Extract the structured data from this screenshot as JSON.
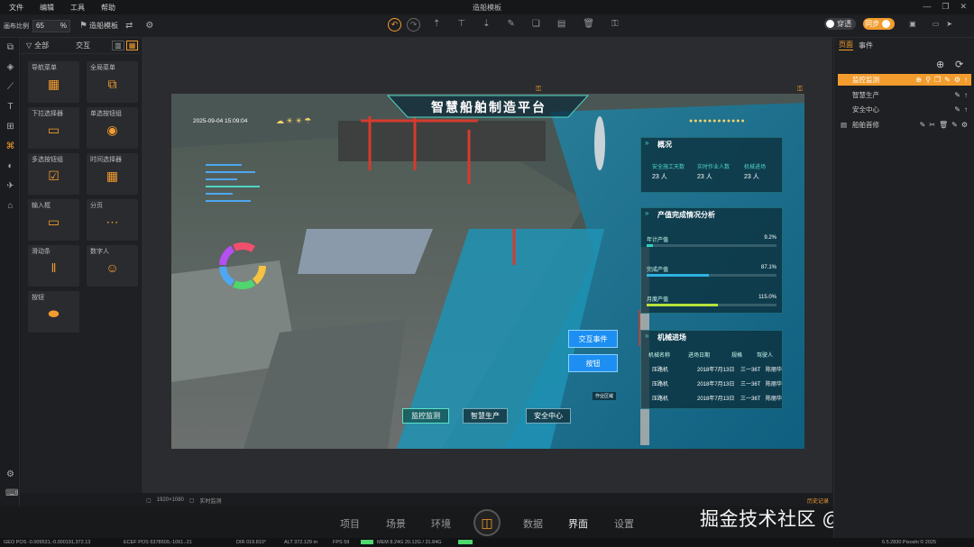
{
  "menu": {
    "items": [
      "文件",
      "编辑",
      "工具",
      "帮助"
    ],
    "title": "造船模板"
  },
  "toolbar": {
    "scale_label": "画布比例",
    "scale_value": "65",
    "scale_unit": "%",
    "template_label": "造船模板"
  },
  "toggles": {
    "left": "穿透",
    "right": "同步"
  },
  "component_panel": {
    "filter_all": "全部",
    "filter_interact": "交互",
    "cards": [
      {
        "label": "导航菜单",
        "icon": "grid-icon"
      },
      {
        "label": "全局菜单",
        "icon": "tree-icon"
      },
      {
        "label": "下拉选择器",
        "icon": "dropdown-icon"
      },
      {
        "label": "单选按钮组",
        "icon": "radio-group-icon"
      },
      {
        "label": "多选按钮组",
        "icon": "checkbox-group-icon"
      },
      {
        "label": "时间选择器",
        "icon": "calendar-icon"
      },
      {
        "label": "输入框",
        "icon": "input-icon"
      },
      {
        "label": "分页",
        "icon": "pagination-icon"
      },
      {
        "label": "滑动条",
        "icon": "slider-icon"
      },
      {
        "label": "数字人",
        "icon": "avatar-icon"
      },
      {
        "label": "按钮",
        "icon": "button-icon"
      }
    ]
  },
  "dashboard": {
    "title": "智慧船舶制造平台",
    "datetime": "2025-09-04 15:09:04",
    "overview": {
      "title": "概况",
      "items": [
        {
          "label": "安全施工天数",
          "value": "23",
          "unit": "人"
        },
        {
          "label": "实时作业人数",
          "value": "23",
          "unit": "人"
        },
        {
          "label": "机械进场",
          "value": "23",
          "unit": "人"
        }
      ]
    },
    "output": {
      "title": "产值完成情况分析",
      "rows": [
        {
          "label": "年计产值",
          "percent": 9.2,
          "display": "9.2%",
          "color": "#2fd2c0"
        },
        {
          "label": "完成产值",
          "percent": 87.1,
          "display": "87.1%",
          "color": "#2fb3e0"
        },
        {
          "label": "月度产值",
          "percent": 115.0,
          "display": "115.0%",
          "color": "#b6e23c"
        }
      ]
    },
    "machinery": {
      "title": "机械进场",
      "headers": [
        "机械名称",
        "进场日期",
        "规格",
        "驾驶人"
      ],
      "rows": [
        [
          "压路机",
          "2018年7月13日",
          "三一36T",
          "陈丽华"
        ],
        [
          "压路机",
          "2018年7月13日",
          "三一36T",
          "陈丽华"
        ],
        [
          "压路机",
          "2018年7月13日",
          "三一36T",
          "陈丽华"
        ]
      ]
    },
    "buttons": {
      "interact": "交互事件",
      "button": "按钮",
      "area": "作业区域"
    },
    "nav": [
      "监控监测",
      "智慧生产",
      "安全中心"
    ]
  },
  "canvas_status": {
    "size": "1920×1080",
    "mode": "实时监测",
    "history": "历史记录"
  },
  "bottom_tabs": [
    "项目",
    "场景",
    "环境",
    "数据",
    "界面",
    "设置"
  ],
  "watermark": "掘金技术社区 @ 智蓝深海",
  "statusbar": {
    "geo": "GEO POS -0.009531,-0.000191,372.13",
    "ecef": "ECEF POS 6378509,-1061,-21",
    "dir": "DIR 019.810°",
    "alt": "ALT 372.129 m",
    "fps": "FPS 59",
    "mem": "MEM 8.24G 20.12G / 31.84G",
    "ver": "6.5.2830 Pixoshi © 2025"
  },
  "right_panel": {
    "tabs": [
      "页面",
      "事件"
    ],
    "pages": [
      {
        "label": "监控监测",
        "selected": true,
        "indent": 1
      },
      {
        "label": "智慧生产",
        "selected": false,
        "indent": 1
      },
      {
        "label": "安全中心",
        "selected": false,
        "indent": 1
      },
      {
        "label": "船舶首修",
        "selected": false,
        "indent": 0
      }
    ]
  },
  "colors": {
    "accent": "#f39c2e",
    "panel_bg": "#1f2023",
    "screen_teal": "#4fd6c4"
  }
}
